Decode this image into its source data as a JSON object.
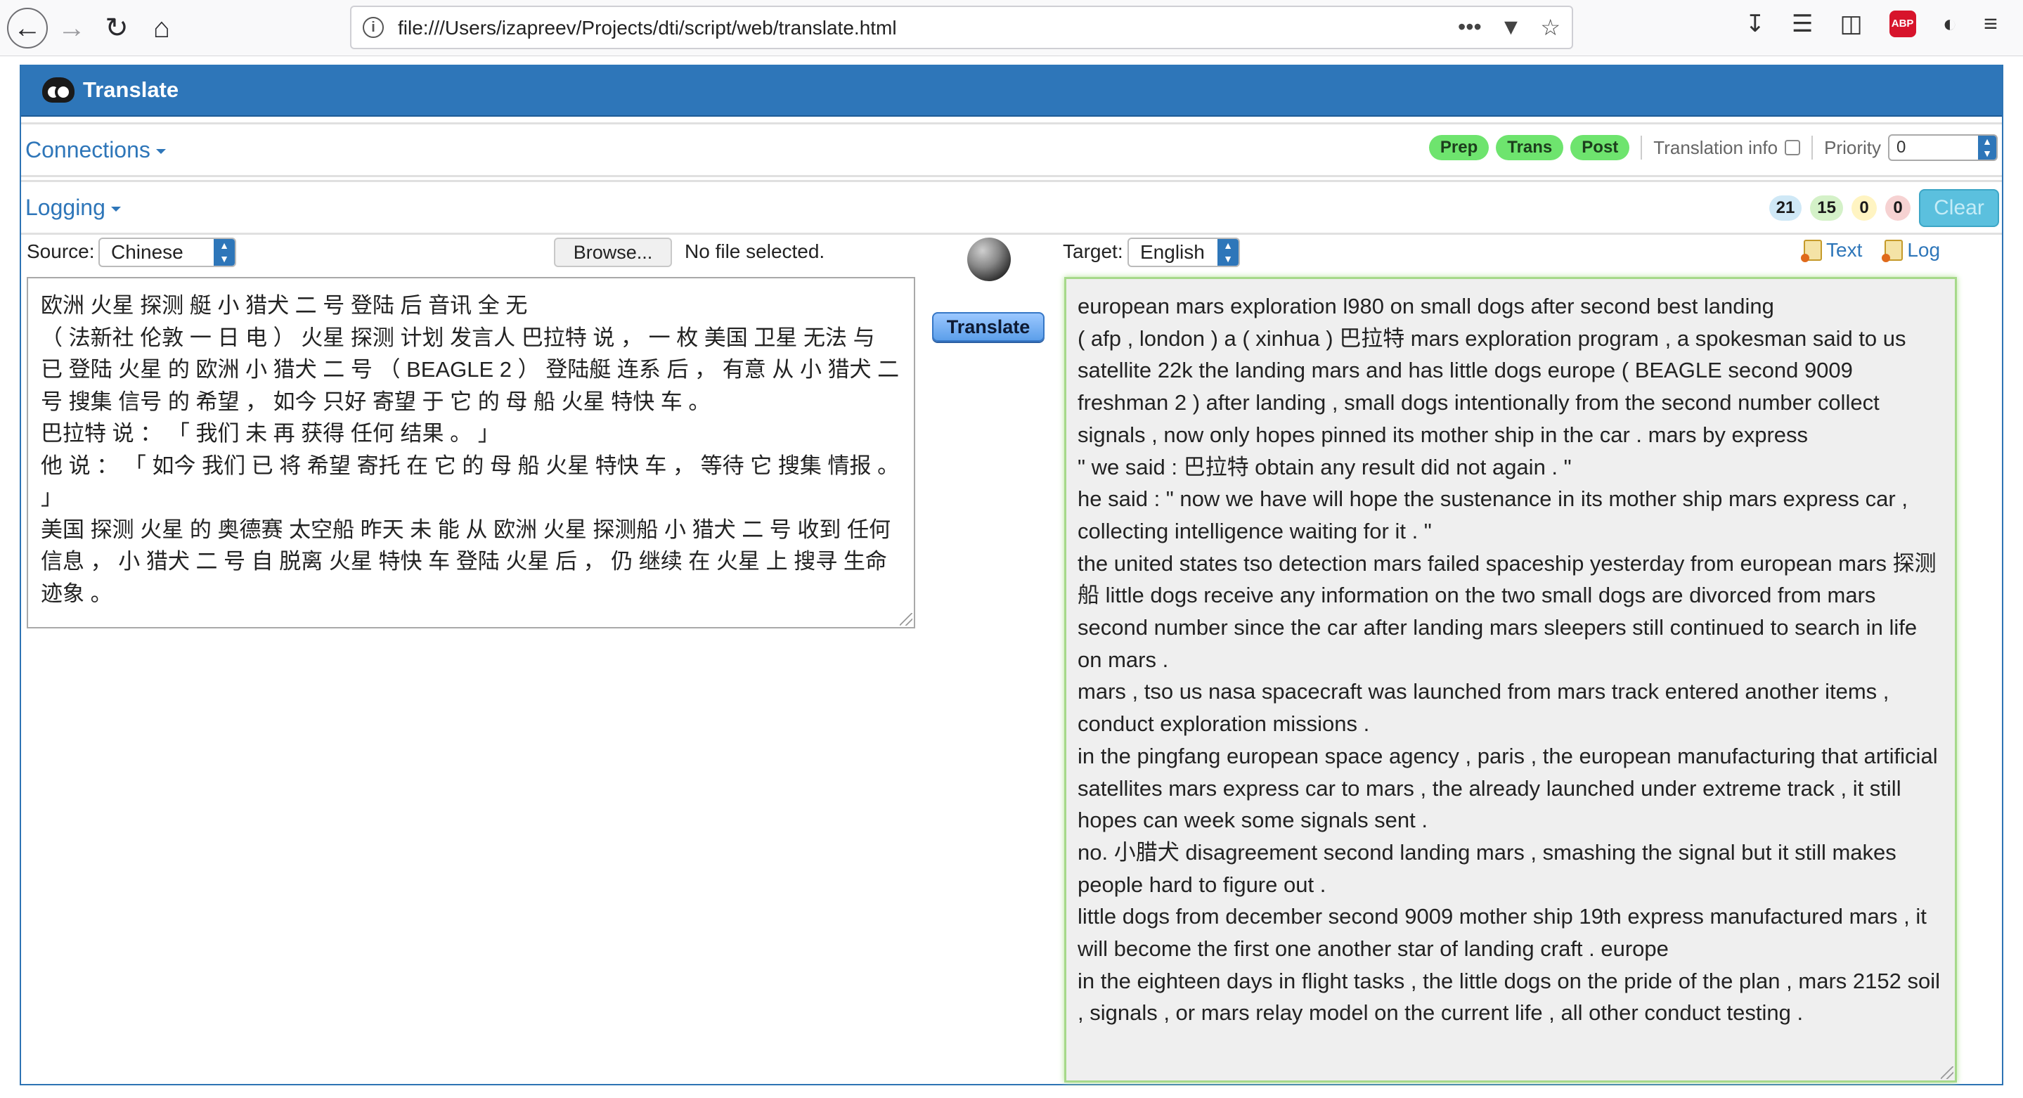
{
  "browser": {
    "url": "file:///Users/izapreev/Projects/dti/script/web/translate.html",
    "url_more": "•••"
  },
  "app": {
    "title": "Translate"
  },
  "connections": {
    "title": "Connections",
    "badges": {
      "prep": "Prep",
      "trans": "Trans",
      "post": "Post"
    },
    "translation_info_label": "Translation info",
    "translation_info_checked": false,
    "priority_label": "Priority",
    "priority_value": "0"
  },
  "logging": {
    "title": "Logging",
    "counts": {
      "info": "21",
      "success": "15",
      "warning": "0",
      "error": "0"
    },
    "clear_label": "Clear"
  },
  "source": {
    "label": "Source:",
    "language": "Chinese",
    "browse_label": "Browse...",
    "file_status": "No file selected.",
    "text": "欧洲 火星 探测 艇 小 猎犬 二 号 登陆 后 音讯 全 无\n（ 法新社 伦敦 一 日 电 ） 火星 探测 计划 发言人 巴拉特 说 ， 一 枚 美国 卫星 无法 与 已 登陆 火星 的 欧洲 小 猎犬 二 号 （ BEAGLE 2 ） 登陆艇 连系 后 ， 有意 从 小 猎犬 二 号 搜集 信号 的 希望 ， 如今 只好 寄望 于 它 的 母 船 火星 特快 车 。\n巴拉特 说 ： 「 我们 未 再 获得 任何 结果 。 」\n他 说 ： 「 如今 我们 已 将 希望 寄托 在 它 的 母 船 火星 特快 车 ， 等待 它 搜集 情报 。 」\n美国 探测 火星 的 奥德赛 太空船 昨天 未 能 从 欧洲 火星 探测船 小 猎犬 二 号 收到 任何 信息 ， 小 猎犬 二 号 自 脱离 火星 特快 车 登陆 火星 后 ， 仍 继续 在 火星 上 搜寻 生命 迹象 。"
  },
  "translate_button": "Translate",
  "target": {
    "label": "Target:",
    "language": "English",
    "text_link": "Text",
    "log_link": "Log",
    "text": "european mars exploration l980 on small dogs after second best landing\n( afp , london ) a ( xinhua ) 巴拉特 mars exploration program , a spokesman said to us satellite 22k the landing mars and has little dogs europe ( BEAGLE second 9009 freshman 2 ) after landing , small dogs intentionally from the second number collect signals , now only hopes pinned its mother ship in the car . mars by express\n\" we said : 巴拉特 obtain any result did not again . \"\nhe said : \" now we have will hope the sustenance in its mother ship mars express car , collecting intelligence waiting for it . \"\nthe united states tso detection mars failed spaceship yesterday from european mars 探测船 little dogs receive any information on the two small dogs are divorced from mars second number since the car after landing mars sleepers still continued to search in life on mars .\nmars , tso us nasa spacecraft was launched from mars track entered another items , conduct exploration missions .\nin the pingfang european space agency , paris , the european manufacturing that artificial satellites mars express car to mars , the already launched under extreme track , it still hopes can week some signals sent .\nno. 小腊犬 disagreement second landing mars , smashing the signal but it still makes people hard to figure out .\nlittle dogs from december second 9009 mother ship 19th express manufactured mars , it will become the first one another star of landing craft . europe\nin the eighteen days in flight tasks , the little dogs on the pride of the plan , mars 2152 soil , signals , or mars relay model on the current life , all other conduct testing ."
  }
}
